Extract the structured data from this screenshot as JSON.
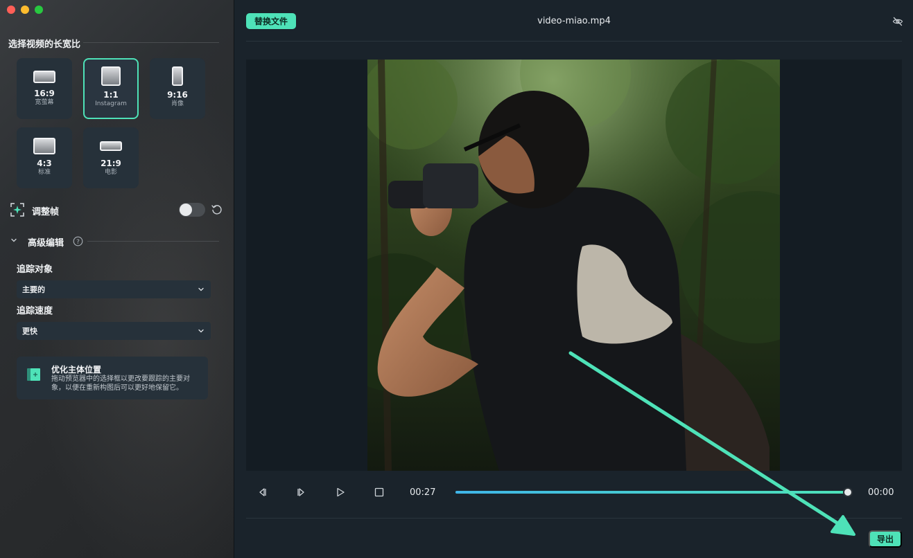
{
  "window": {
    "title": "video-miao.mp4"
  },
  "sidebar": {
    "aspect_title": "选择视频的长宽比",
    "ratios": [
      {
        "value": "16:9",
        "label": "宽萤幕",
        "selected": false
      },
      {
        "value": "1:1",
        "label": "Instagram",
        "selected": true
      },
      {
        "value": "9:16",
        "label": "肖像",
        "selected": false
      },
      {
        "value": "4:3",
        "label": "标准",
        "selected": false
      },
      {
        "value": "21:9",
        "label": "电影",
        "selected": false
      }
    ],
    "adjust_frame": {
      "label": "调整帧",
      "enabled": false
    },
    "advanced": {
      "label": "高级编辑",
      "track_object_label": "追踪对象",
      "track_object_value": "主要的",
      "track_speed_label": "追踪速度",
      "track_speed_value": "更快"
    },
    "tip": {
      "title": "优化主体位置",
      "body": "拖动预览器中的选择框以更改要跟踪的主要对象，以便在重新构图后可以更好地保留它。"
    }
  },
  "main": {
    "replace_button": "替换文件",
    "playback": {
      "current_time": "00:27",
      "end_time": "00:00",
      "progress": 1.0
    },
    "export_button": "导出"
  },
  "colors": {
    "accent": "#4ee2b8",
    "progress_start": "#3fb5e8",
    "background": "#1a232b",
    "sidebar": "#2c2f32"
  }
}
